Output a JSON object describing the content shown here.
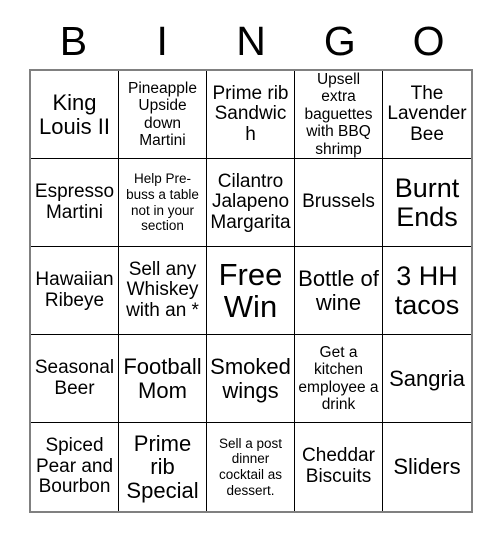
{
  "card": {
    "title": "BINGO",
    "header_letters": [
      "B",
      "I",
      "N",
      "G",
      "O"
    ],
    "colors": {
      "background": "#ffffff",
      "text": "#000000",
      "cell_border": "#000000",
      "grid_outline": "#808080"
    },
    "grid": {
      "columns": 5,
      "rows": 5,
      "free_space": {
        "row": 3,
        "column": 3,
        "label": "Free Win"
      }
    },
    "cells": [
      {
        "text": "King Louis II",
        "size": "fs-l"
      },
      {
        "text": "Pineapple Upside down Martini",
        "size": "fs-s"
      },
      {
        "text": "Prime rib Sandwich",
        "size": "fs-m"
      },
      {
        "text": "Upsell extra baguettes with BBQ shrimp",
        "size": "fs-s"
      },
      {
        "text": "The Lavender Bee",
        "size": "fs-m"
      },
      {
        "text": "Espresso Martini",
        "size": "fs-m"
      },
      {
        "text": "Help Pre-buss a table not in your section",
        "size": "fs-xs"
      },
      {
        "text": "Cilantro Jalapeno Margarita",
        "size": "fs-m"
      },
      {
        "text": "Brussels",
        "size": "fs-m"
      },
      {
        "text": "Burnt Ends",
        "size": "fs-xl"
      },
      {
        "text": "Hawaiian Ribeye",
        "size": "fs-m"
      },
      {
        "text": "Sell any Whiskey with an *",
        "size": "fs-m"
      },
      {
        "text": "Free Win",
        "size": "fs-xxl"
      },
      {
        "text": "Bottle of wine",
        "size": "fs-l"
      },
      {
        "text": "3 HH tacos",
        "size": "fs-xl"
      },
      {
        "text": "Seasonal Beer",
        "size": "fs-m"
      },
      {
        "text": "Football Mom",
        "size": "fs-l"
      },
      {
        "text": "Smoked wings",
        "size": "fs-l"
      },
      {
        "text": "Get a kitchen employee a drink",
        "size": "fs-s"
      },
      {
        "text": "Sangria",
        "size": "fs-l"
      },
      {
        "text": "Spiced Pear and Bourbon",
        "size": "fs-m"
      },
      {
        "text": "Prime rib Special",
        "size": "fs-l"
      },
      {
        "text": "Sell a post dinner cocktail as dessert.",
        "size": "fs-xs"
      },
      {
        "text": "Cheddar Biscuits",
        "size": "fs-m"
      },
      {
        "text": "Sliders",
        "size": "fs-l"
      }
    ]
  }
}
